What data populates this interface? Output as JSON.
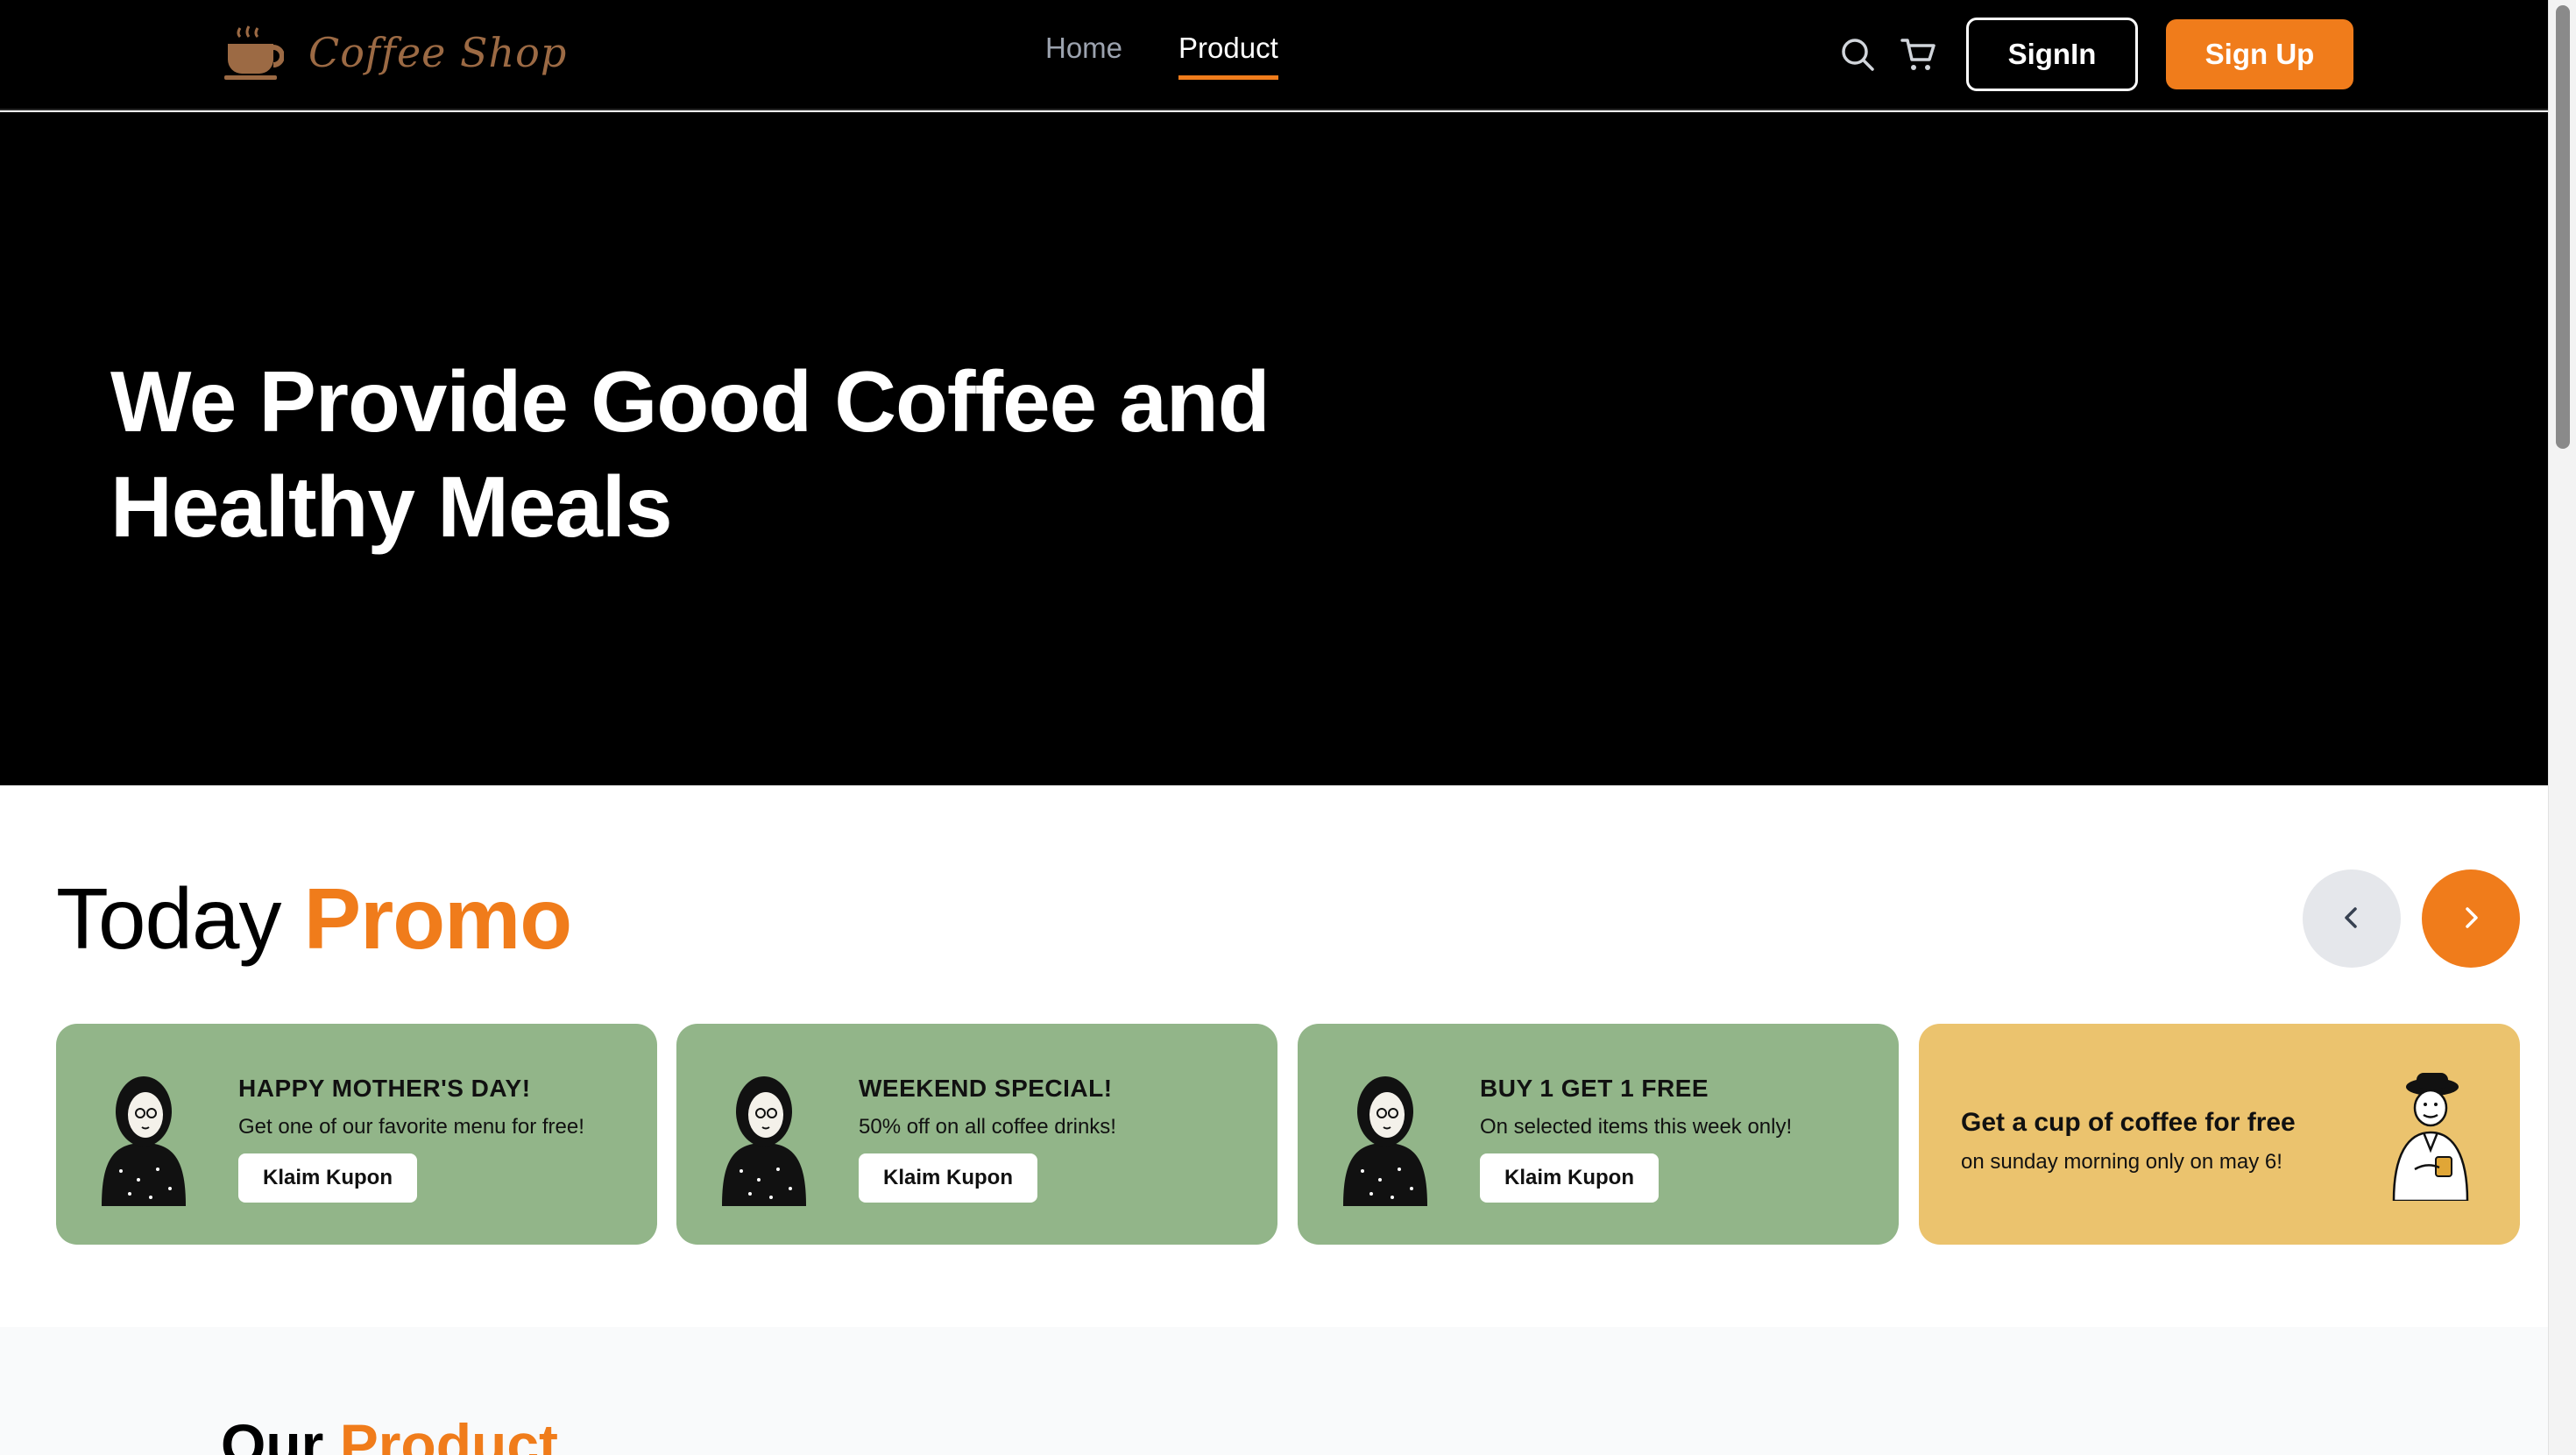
{
  "brand": {
    "name": "Coffee Shop",
    "logo_icon": "coffee-cup-icon",
    "logo_color": "#9c6a44"
  },
  "nav": {
    "links": [
      {
        "label": "Home",
        "active": false
      },
      {
        "label": "Product",
        "active": true
      }
    ],
    "search_icon": "search-icon",
    "cart_icon": "cart-icon",
    "signin_label": "SignIn",
    "signup_label": "Sign Up"
  },
  "hero": {
    "title": "We Provide Good Coffee and Healthy Meals"
  },
  "promo": {
    "heading_plain": "Today",
    "heading_accent": "Promo",
    "prev_icon": "chevron-left-icon",
    "next_icon": "chevron-right-icon",
    "cards": [
      {
        "title": "HAPPY MOTHER'S DAY!",
        "subtitle": "Get one of our favorite menu for free!",
        "button": "Klaim Kupon",
        "color": "#92b589"
      },
      {
        "title": "WEEKEND SPECIAL!",
        "subtitle": "50% off on all coffee drinks!",
        "button": "Klaim Kupon",
        "color": "#92b589"
      },
      {
        "title": "BUY 1 GET 1 FREE",
        "subtitle": "On selected items this week only!",
        "button": "Klaim Kupon",
        "color": "#92b589"
      },
      {
        "title": "Get a cup of coffee for free",
        "subtitle": "on sunday morning only on may 6!",
        "color": "#ebc36e"
      }
    ]
  },
  "product": {
    "heading_plain": "Our",
    "heading_accent": "Product"
  },
  "colors": {
    "accent": "#f07c1b",
    "background_dark": "#000000",
    "promo_green": "#92b589",
    "promo_yellow": "#ebc36e"
  }
}
